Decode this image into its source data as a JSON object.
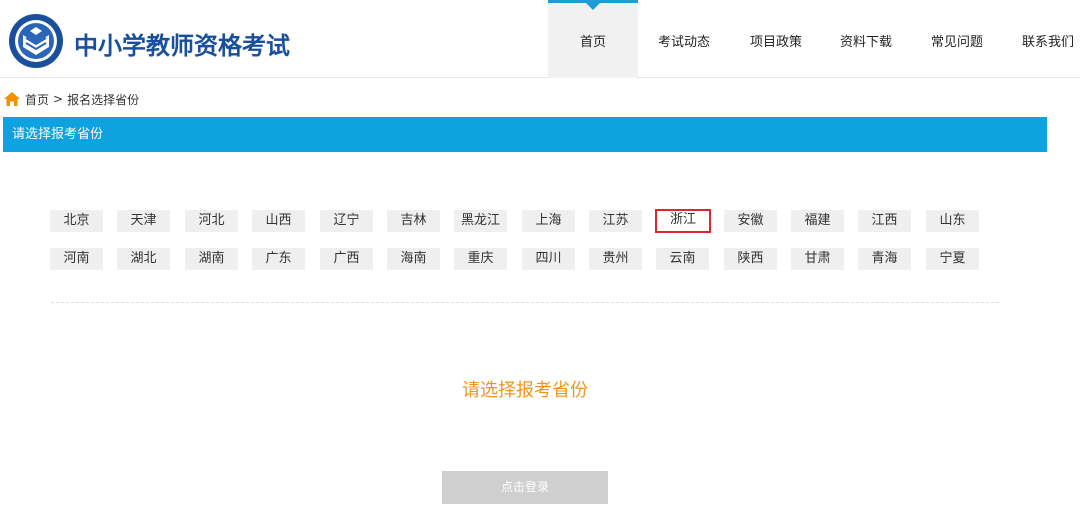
{
  "header": {
    "brand": "中小学教师资格考试",
    "nav": [
      "首页",
      "考试动态",
      "项目政策",
      "资料下载",
      "常见问题",
      "联系我们"
    ],
    "active_nav": "首页"
  },
  "breadcrumb": {
    "home": "首页",
    "separator": ">",
    "current": "报名选择省份"
  },
  "title_bar": "请选择报考省份",
  "provinces": {
    "row1": [
      "北京",
      "天津",
      "河北",
      "山西",
      "辽宁",
      "吉林",
      "黑龙江",
      "上海",
      "江苏",
      "浙江",
      "安徽",
      "福建",
      "江西",
      "山东"
    ],
    "row2": [
      "河南",
      "湖北",
      "湖南",
      "广东",
      "广西",
      "海南",
      "重庆",
      "四川",
      "贵州",
      "云南",
      "陕西",
      "甘肃",
      "青海",
      "宁夏"
    ],
    "selected": "浙江"
  },
  "prompt": "请选择报考省份",
  "login_button": "点击登录",
  "colors": {
    "brand": "#1a4f9c",
    "accent": "#0fa2e0",
    "prompt": "#f3931c",
    "selected_border": "#e0262b",
    "home_icon": "#f39200"
  },
  "icons": {
    "logo": "emblem-book-icon",
    "home": "home-icon",
    "active_nav": "caret-down-icon"
  }
}
